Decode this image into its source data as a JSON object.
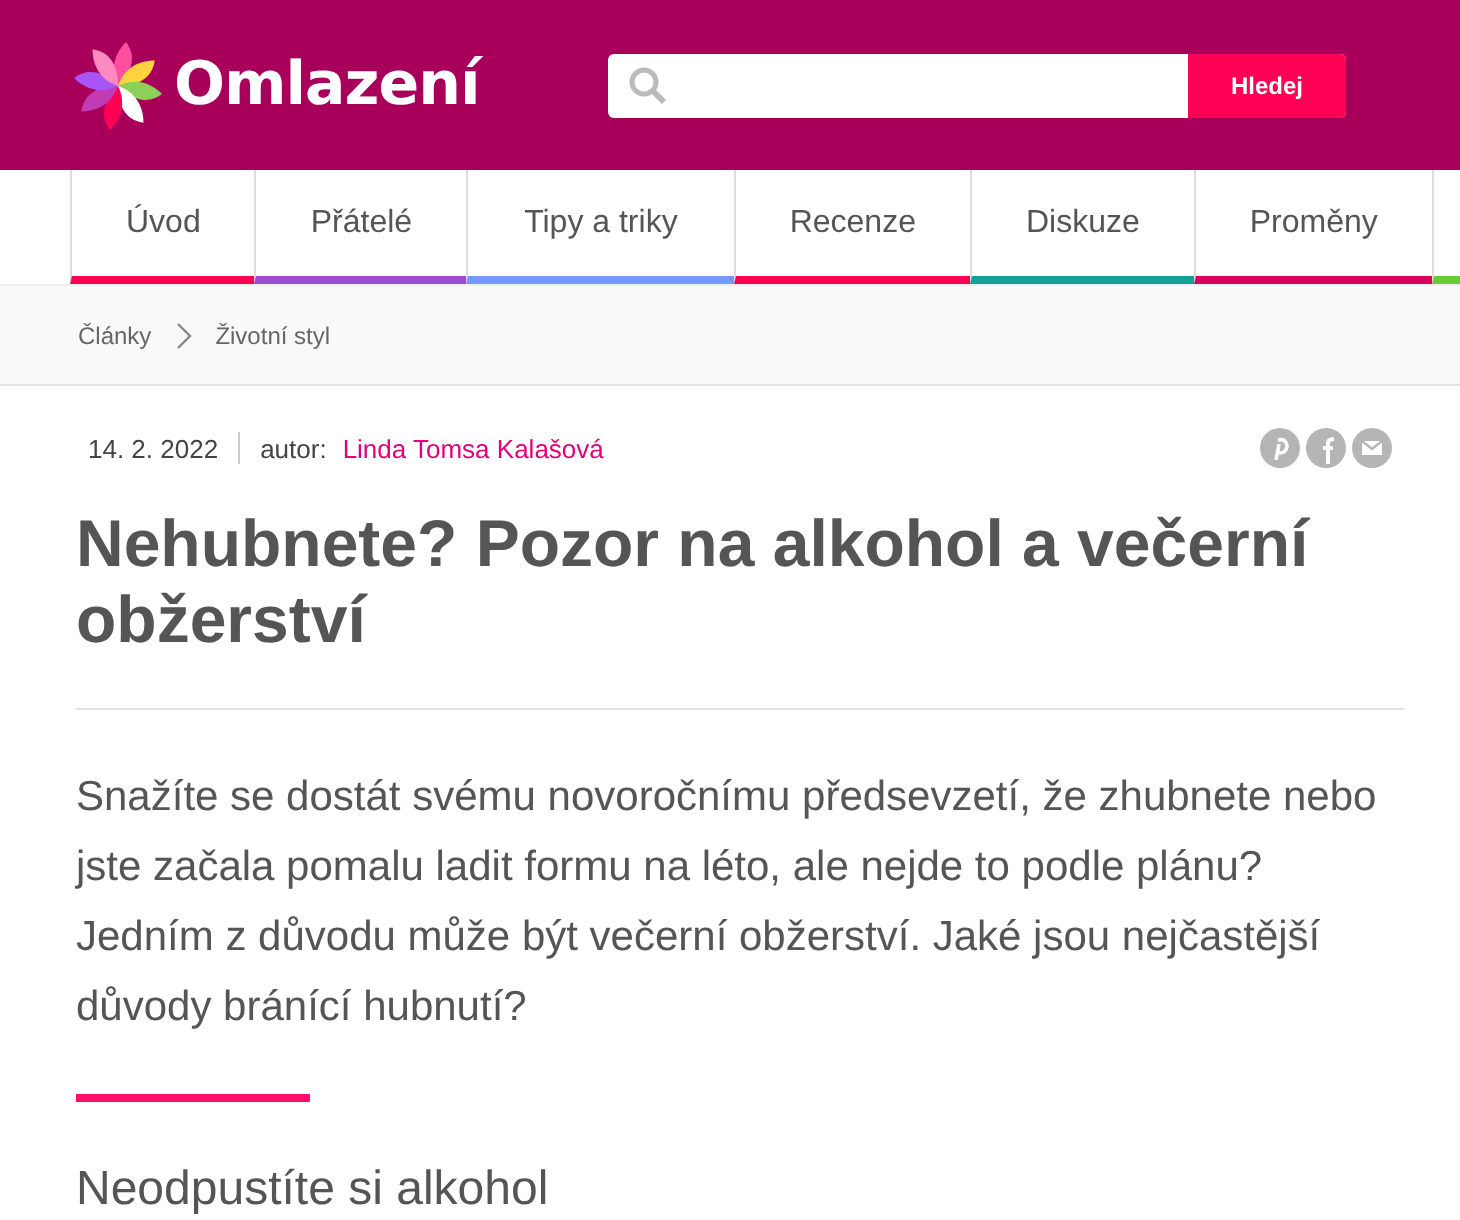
{
  "header": {
    "logo_text": "Omlazení",
    "search": {
      "button": "Hledej"
    }
  },
  "nav": [
    {
      "label": "Úvod",
      "color": "#ff0055"
    },
    {
      "label": "Přátelé",
      "color": "#9b4fd0"
    },
    {
      "label": "Tipy a triky",
      "color": "#7799ff"
    },
    {
      "label": "Recenze",
      "color": "#ff0055"
    },
    {
      "label": "Diskuze",
      "color": "#14a098"
    },
    {
      "label": "Proměny",
      "color": "#d8005a"
    }
  ],
  "breadcrumb": [
    "Články",
    "Životní styl"
  ],
  "article": {
    "date": "14. 2. 2022",
    "author_label": "autor:",
    "author": "Linda Tomsa Kalašová",
    "title": "Nehubnete? Pozor na alkohol a večerní obžerství",
    "lead": "Snažíte se dostát svému novoročnímu předsevzetí, že zhubnete nebo jste začala pomalu ladit formu na léto, ale nejde to podle plánu? Jedním z důvodu může být večerní obžerství. Jaké jsou nejčastější důvody bránící hubnutí?",
    "subheading": "Neodpustíte si alkohol"
  }
}
